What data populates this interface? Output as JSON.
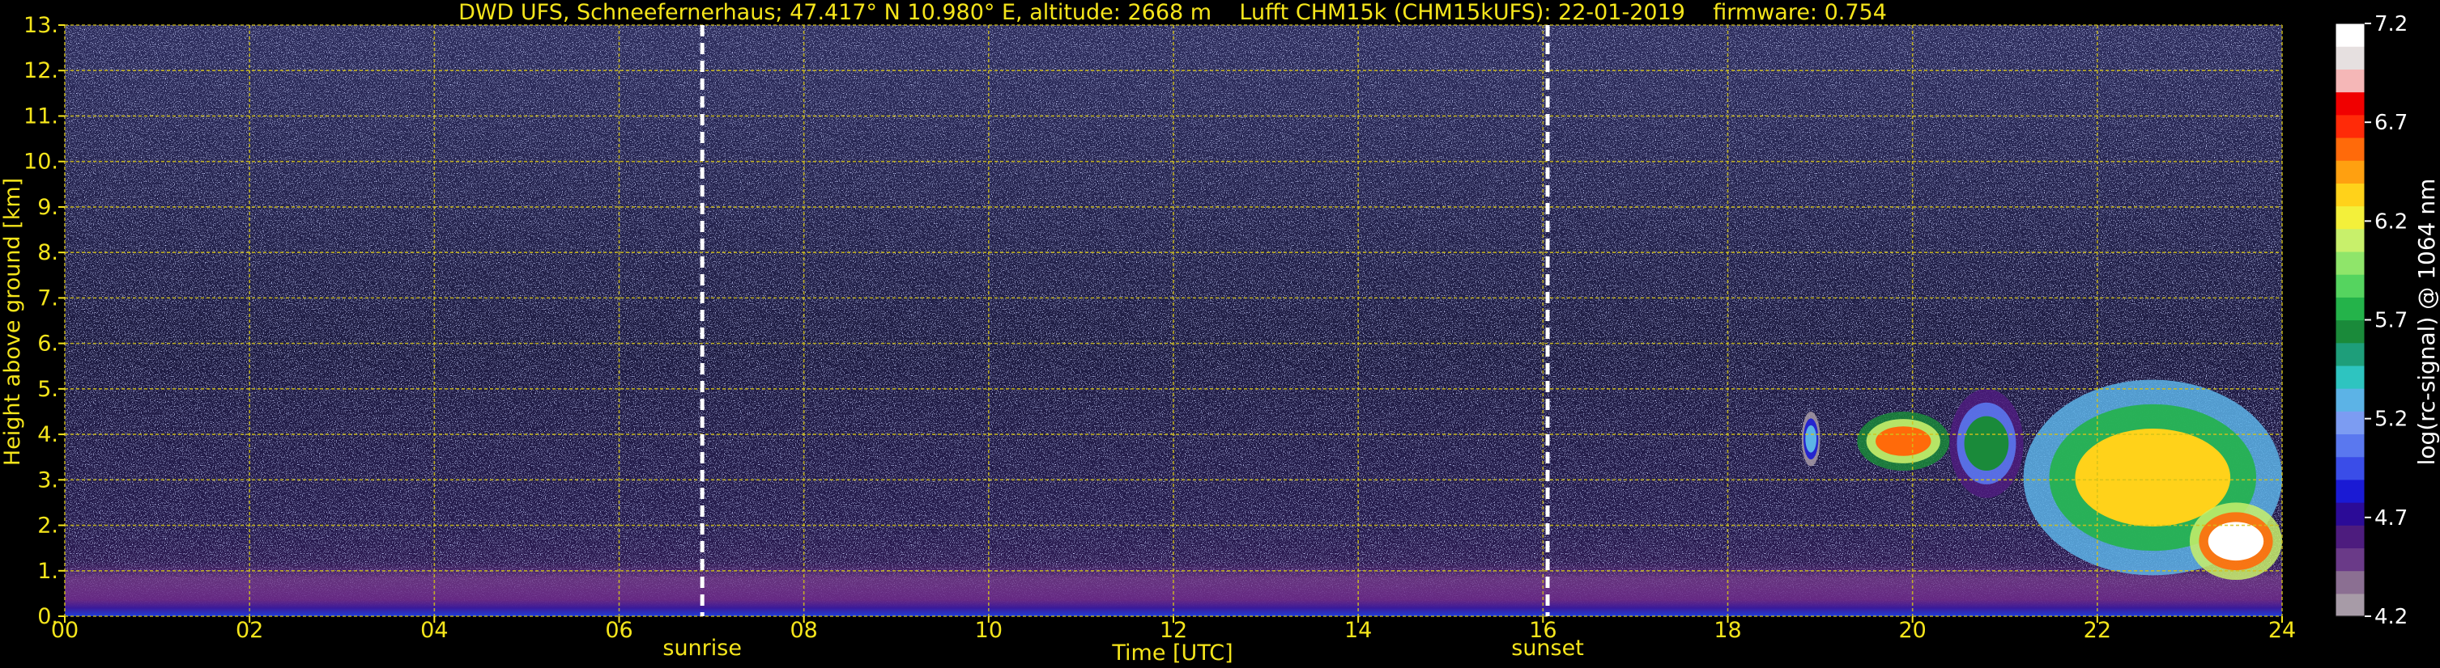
{
  "chart_data": {
    "type": "heatmap",
    "title": "DWD UFS, Schneefernerhaus; 47.417° N 10.980° E, altitude: 2668 m    Lufft CHM15k (CHM15kUFS): 22-01-2019    firmware: 0.754",
    "xlabel": "Time [UTC]",
    "ylabel": "Height above ground [km]",
    "xlim": [
      0,
      24
    ],
    "ylim": [
      0,
      13
    ],
    "x_ticks": [
      "00",
      "02",
      "04",
      "06",
      "08",
      "10",
      "12",
      "14",
      "16",
      "18",
      "20",
      "22",
      "24"
    ],
    "y_ticks": [
      "0.",
      "1.",
      "2.",
      "3.",
      "4.",
      "5.",
      "6.",
      "7.",
      "8.",
      "9.",
      "10.",
      "11.",
      "12.",
      "13."
    ],
    "grid": true,
    "annotations": [
      {
        "text": "sunrise",
        "x": 6.9
      },
      {
        "text": "sunset",
        "x": 16.05
      }
    ],
    "colorbar": {
      "label": "log(rc-signal) @ 1064 nm",
      "range": [
        4.2,
        7.2
      ],
      "ticks": [
        "4.2",
        "4.7",
        "5.2",
        "5.7",
        "6.2",
        "6.7",
        "7.2"
      ],
      "colors": [
        "#a79ba7",
        "#8b6f92",
        "#6a3a88",
        "#4d1c7e",
        "#2b0b97",
        "#1a1ad4",
        "#3a4de8",
        "#5a78ef",
        "#7c9cf2",
        "#5cb3e6",
        "#2ec4c0",
        "#1e9e7a",
        "#1a8a3a",
        "#24b34a",
        "#55d45f",
        "#8fe56a",
        "#c8f06b",
        "#f3f03a",
        "#ffd21a",
        "#ffa010",
        "#ff6a0a",
        "#ff2a08",
        "#f00000",
        "#f5b7b7",
        "#e6e0e0",
        "#ffffff"
      ]
    },
    "cloud_layers": [
      {
        "t0": 18.8,
        "t1": 19.0,
        "h0": 3.3,
        "h1": 4.5,
        "intensity": 5.3
      },
      {
        "t0": 19.4,
        "t1": 20.4,
        "h0": 3.2,
        "h1": 4.5,
        "intensity": 6.6
      },
      {
        "t0": 20.4,
        "t1": 21.2,
        "h0": 2.6,
        "h1": 5.0,
        "intensity": 5.6
      },
      {
        "t0": 21.2,
        "t1": 24.0,
        "h0": 0.9,
        "h1": 5.2,
        "intensity": 6.3
      },
      {
        "t0": 23.0,
        "t1": 24.0,
        "h0": 0.8,
        "h1": 2.5,
        "intensity": 7.1
      }
    ],
    "surface_layer": {
      "h0": 0.0,
      "h1": 1.2,
      "intensity": 4.8
    }
  }
}
